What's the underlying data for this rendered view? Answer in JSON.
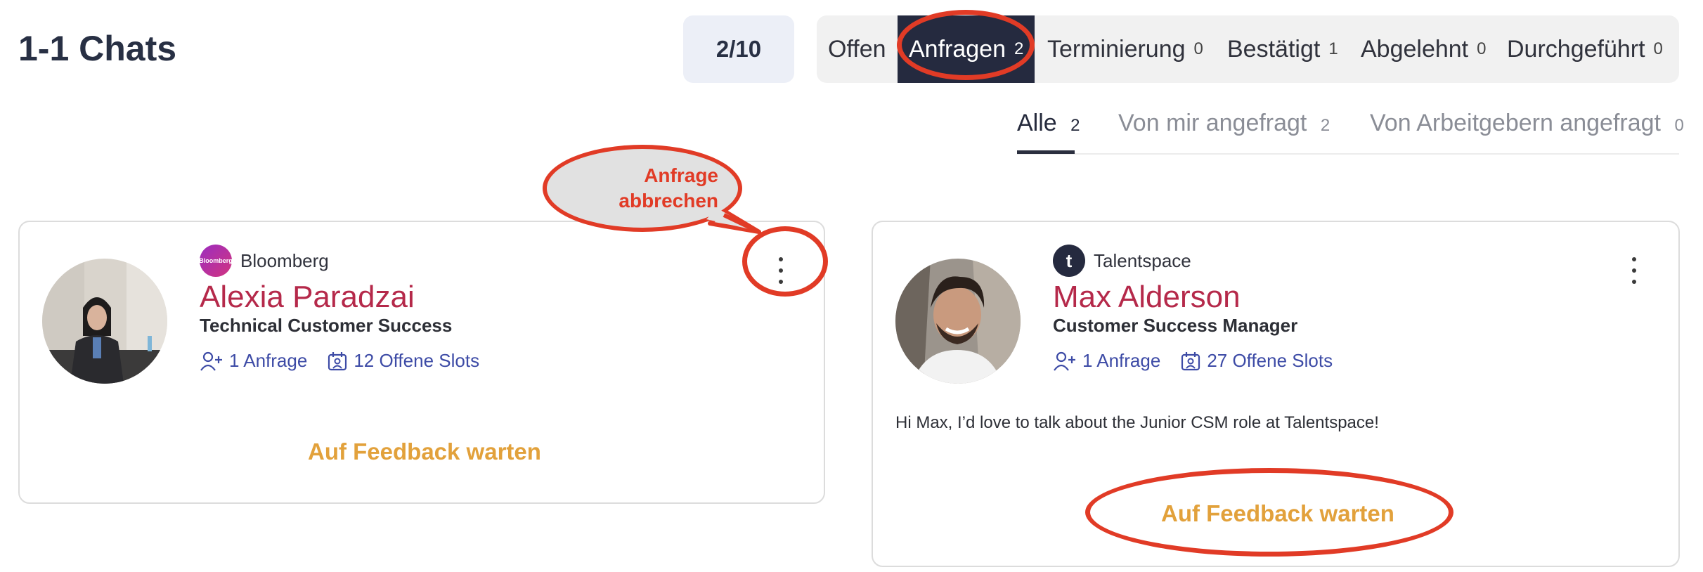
{
  "page_title": "1-1 Chats",
  "counter": "2/10",
  "tabs": [
    {
      "label": "Offen",
      "count": ""
    },
    {
      "label": "Anfragen",
      "count": "2"
    },
    {
      "label": "Terminierung",
      "count": "0"
    },
    {
      "label": "Bestätigt",
      "count": "1"
    },
    {
      "label": "Abgelehnt",
      "count": "0"
    },
    {
      "label": "Durchgeführt",
      "count": "0"
    }
  ],
  "subtabs": [
    {
      "label": "Alle",
      "count": "2"
    },
    {
      "label": "Von mir angefragt",
      "count": "2"
    },
    {
      "label": "Von Arbeitgebern angefragt",
      "count": "0"
    }
  ],
  "callout": {
    "line1": "Anfrage",
    "line2": "abbrechen"
  },
  "cards": [
    {
      "company": "Bloomberg",
      "company_logo_text": "Bloomberg",
      "name": "Alexia Paradzai",
      "role": "Technical Customer Success",
      "requests": "1 Anfrage",
      "slots": "12 Offene Slots",
      "status": "Auf Feedback warten"
    },
    {
      "company": "Talentspace",
      "company_logo_text": "t",
      "name": "Max Alderson",
      "role": "Customer Success Manager",
      "requests": "1 Anfrage",
      "slots": "27 Offene Slots",
      "message": "Hi Max, I’d love to talk about the Junior CSM role at Talentspace!",
      "status": "Auf Feedback warten"
    }
  ],
  "colors": {
    "accent_name": "#b5294a",
    "status": "#e2a13b",
    "link": "#3d4ba6",
    "active_tab_bg": "#252a3f",
    "annotation": "#e13b26"
  }
}
